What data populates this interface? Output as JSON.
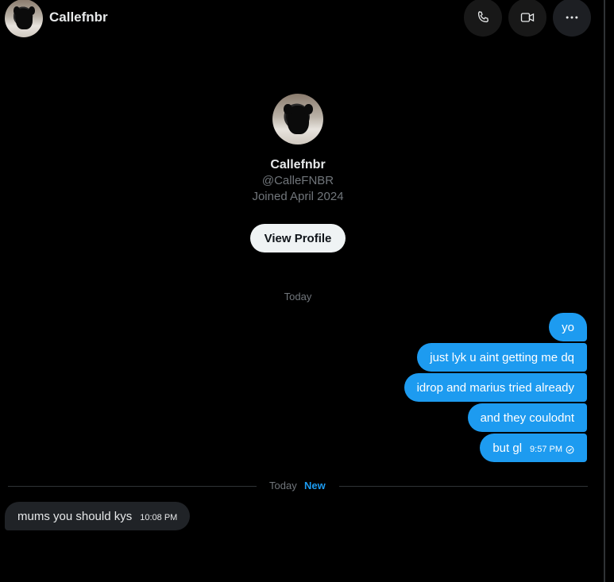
{
  "header": {
    "name": "Callefnbr",
    "avatar_icon": "puppy-avatar",
    "call_icon": "phone-icon",
    "video_icon": "video-camera-icon",
    "more_icon": "more-horizontal-icon"
  },
  "profile": {
    "name": "Callefnbr",
    "handle": "@CalleFNBR",
    "joined": "Joined April 2024",
    "button_label": "View Profile"
  },
  "day_label": "Today",
  "outgoing": [
    {
      "text": "yo"
    },
    {
      "text": "just lyk u aint getting me dq"
    },
    {
      "text": "idrop and marius tried already"
    },
    {
      "text": "and they coulodnt"
    },
    {
      "text": "but gl",
      "time": "9:57 PM"
    }
  ],
  "divider": {
    "label": "Today",
    "badge": "New"
  },
  "incoming": [
    {
      "text": "mums you should kys",
      "time": "10:08 PM"
    }
  ],
  "colors": {
    "background": "#000000",
    "accent": "#1d9bf0",
    "incoming_bubble": "#202327",
    "muted_text": "#71767b"
  }
}
